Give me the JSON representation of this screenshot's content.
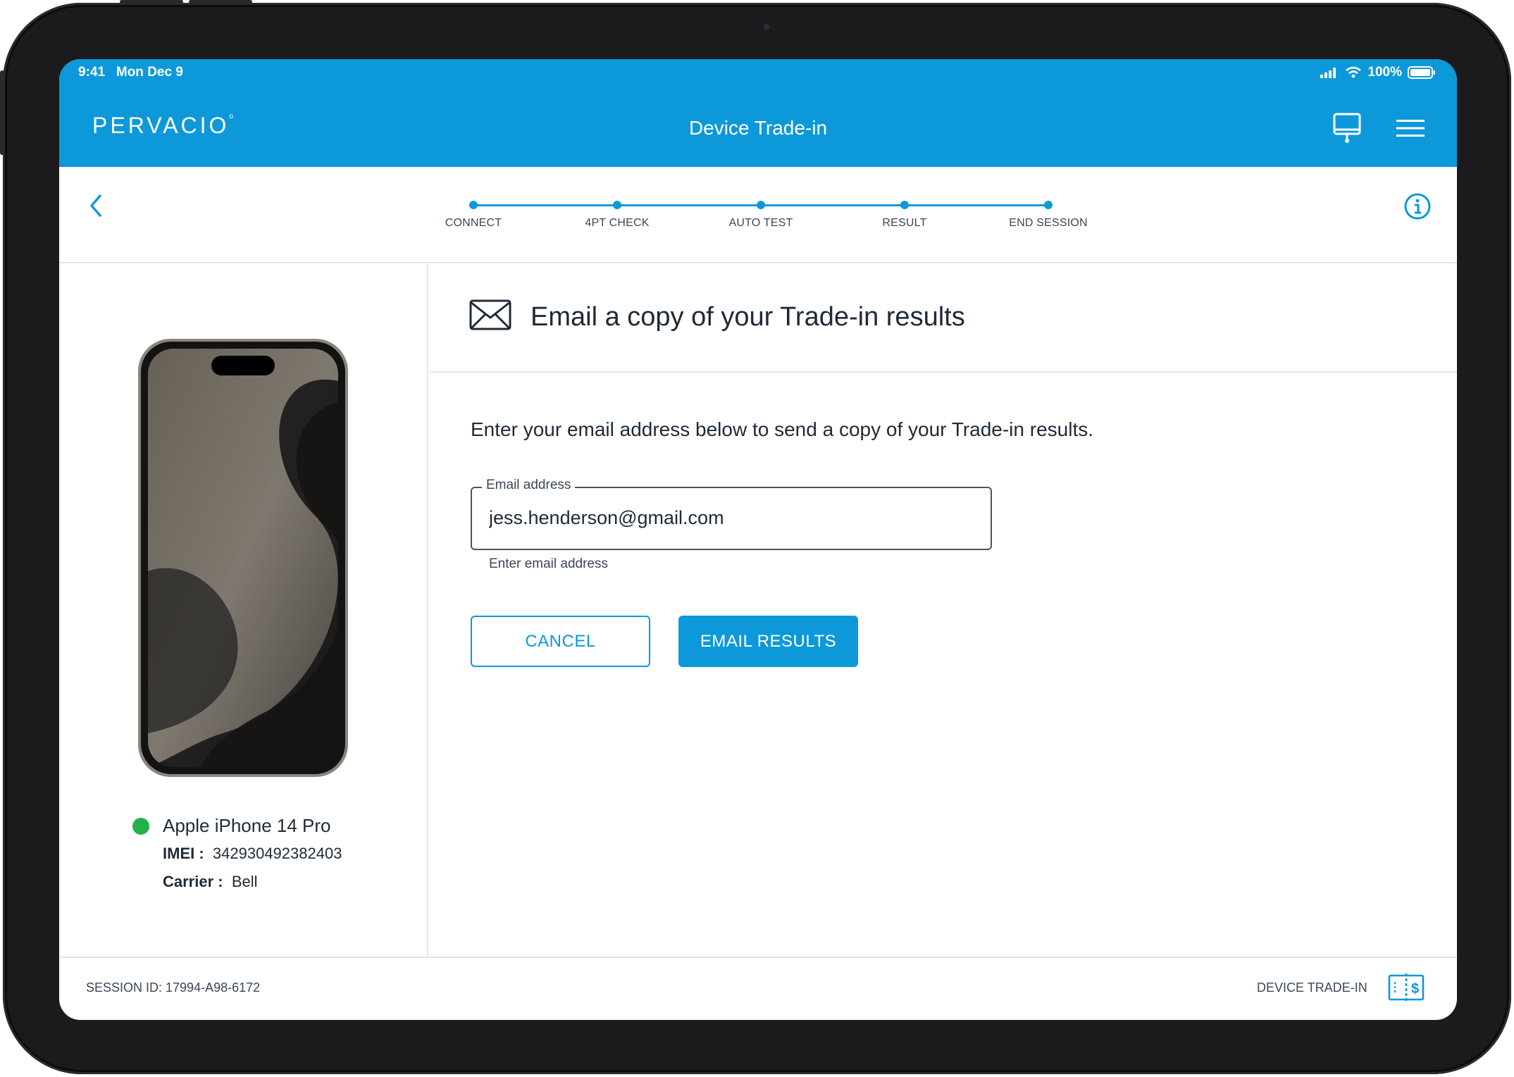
{
  "status_bar": {
    "time": "9:41",
    "date": "Mon Dec 9",
    "battery": "100%"
  },
  "header": {
    "logo": "PERVACIO",
    "title": "Device Trade-in",
    "icons": [
      "monitor-icon",
      "hamburger-menu-icon"
    ]
  },
  "stepper": {
    "steps": [
      {
        "label": "CONNECT"
      },
      {
        "label": "4PT CHECK"
      },
      {
        "label": "AUTO TEST"
      },
      {
        "label": "RESULT"
      },
      {
        "label": "END SESSION"
      }
    ]
  },
  "device": {
    "name": "Apple iPhone 14 Pro",
    "imei_label": "IMEI :",
    "imei": "342930492382403",
    "carrier_label": "Carrier :",
    "carrier": "Bell",
    "status_color": "#22b24c"
  },
  "main": {
    "title": "Email a copy of your Trade-in results",
    "instructions": "Enter your email address below to send a copy of your Trade-in results.",
    "email_field": {
      "label": "Email address",
      "value": "jess.henderson@gmail.com",
      "helper": "Enter email address"
    },
    "cancel_label": "CANCEL",
    "submit_label": "EMAIL RESULTS"
  },
  "footer": {
    "session": "SESSION ID: 17994-A98-6172",
    "mode": "DEVICE TRADE-IN"
  },
  "colors": {
    "brand": "#0d99d9",
    "text": "#1f2a37",
    "divider": "#e4e8ec"
  }
}
